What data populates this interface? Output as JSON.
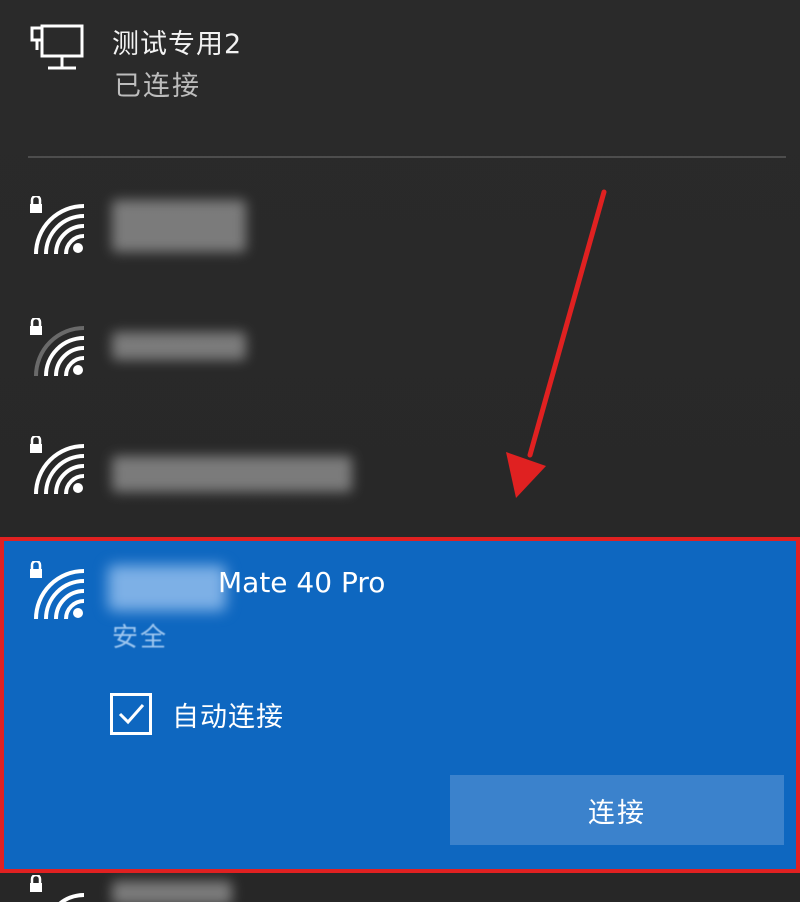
{
  "ethernet": {
    "icon": "ethernet-icon",
    "name": "测试专用2",
    "status": "已连接"
  },
  "networks": [
    {
      "icon": "wifi-secured-icon",
      "name_hidden": true
    },
    {
      "icon": "wifi-secured-icon",
      "name_hidden": true
    },
    {
      "icon": "wifi-secured-icon",
      "name_hidden": true
    }
  ],
  "selected_network": {
    "icon": "wifi-secured-icon",
    "name": "Mate 40 Pro",
    "security": "安全",
    "auto_connect_label": "自动连接",
    "auto_connect_checked": true,
    "connect_label": "连接"
  },
  "colors": {
    "accent": "#0e67c0",
    "button": "#3b82cc",
    "highlight_border": "#e02121",
    "background": "#2b2b2b"
  }
}
